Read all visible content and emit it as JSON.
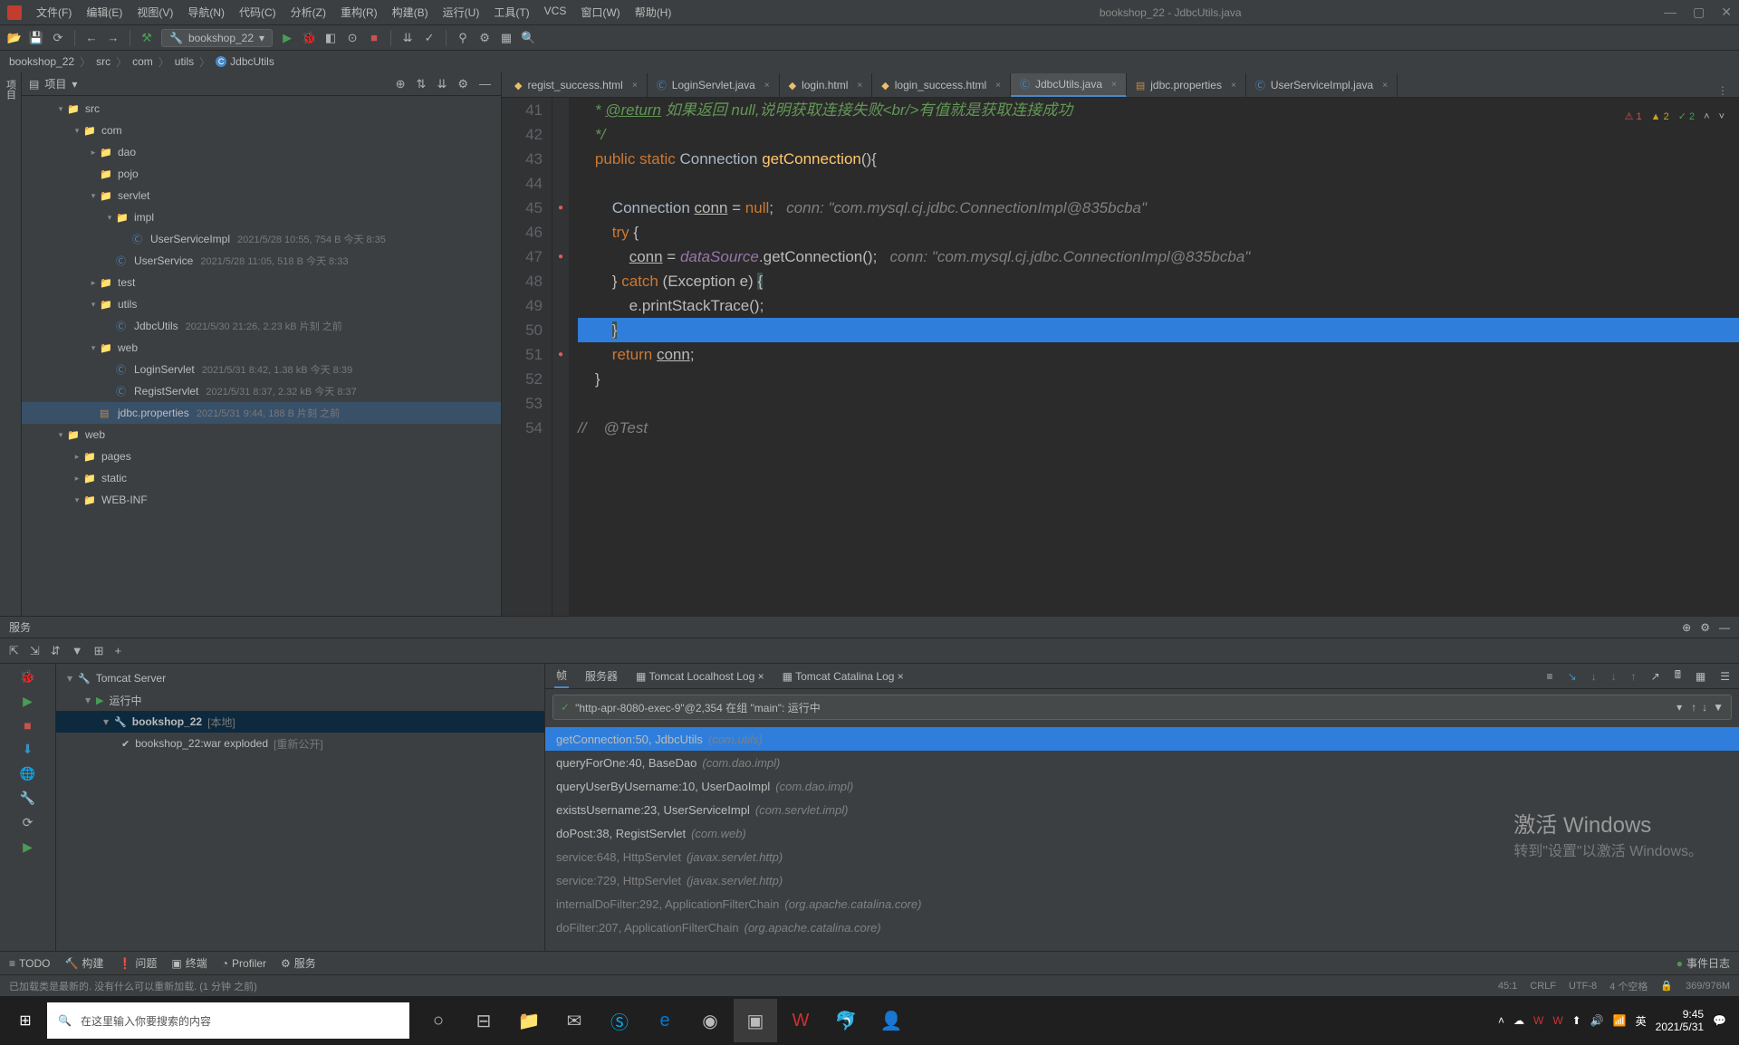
{
  "window": {
    "title": "bookshop_22 - JdbcUtils.java"
  },
  "menus": [
    "文件(F)",
    "编辑(E)",
    "视图(V)",
    "导航(N)",
    "代码(C)",
    "分析(Z)",
    "重构(R)",
    "构建(B)",
    "运行(U)",
    "工具(T)",
    "VCS",
    "窗口(W)",
    "帮助(H)"
  ],
  "runconfig": "bookshop_22",
  "breadcrumb": [
    "bookshop_22",
    "src",
    "com",
    "utils",
    "JdbcUtils"
  ],
  "project_title": "项目",
  "tree": [
    {
      "d": 2,
      "ic": "dir",
      "t": "src",
      "arrow": "▾"
    },
    {
      "d": 3,
      "ic": "dir",
      "t": "com",
      "arrow": "▾"
    },
    {
      "d": 4,
      "ic": "dir",
      "t": "dao",
      "arrow": "▸"
    },
    {
      "d": 4,
      "ic": "dir",
      "t": "pojo",
      "arrow": ""
    },
    {
      "d": 4,
      "ic": "dir",
      "t": "servlet",
      "arrow": "▾"
    },
    {
      "d": 5,
      "ic": "dir",
      "t": "impl",
      "arrow": "▾"
    },
    {
      "d": 6,
      "ic": "cls",
      "t": "UserServiceImpl",
      "meta": "2021/5/28 10:55, 754 B 今天 8:35"
    },
    {
      "d": 5,
      "ic": "cls",
      "t": "UserService",
      "meta": "2021/5/28 11:05, 518 B 今天 8:33"
    },
    {
      "d": 4,
      "ic": "dir",
      "t": "test",
      "arrow": "▸"
    },
    {
      "d": 4,
      "ic": "dir",
      "t": "utils",
      "arrow": "▾"
    },
    {
      "d": 5,
      "ic": "cls",
      "t": "JdbcUtils",
      "meta": "2021/5/30 21:26, 2.23 kB 片刻 之前"
    },
    {
      "d": 4,
      "ic": "dir",
      "t": "web",
      "arrow": "▾"
    },
    {
      "d": 5,
      "ic": "cls",
      "t": "LoginServlet",
      "meta": "2021/5/31 8:42, 1.38 kB 今天 8:39"
    },
    {
      "d": 5,
      "ic": "cls",
      "t": "RegistServlet",
      "meta": "2021/5/31 8:37, 2.32 kB 今天 8:37"
    },
    {
      "d": 4,
      "ic": "prop",
      "t": "jdbc.properties",
      "meta": "2021/5/31 9:44, 188 B 片刻 之前",
      "sel": true
    },
    {
      "d": 2,
      "ic": "dir",
      "t": "web",
      "arrow": "▾"
    },
    {
      "d": 3,
      "ic": "dir",
      "t": "pages",
      "arrow": "▸"
    },
    {
      "d": 3,
      "ic": "dir",
      "t": "static",
      "arrow": "▸"
    },
    {
      "d": 3,
      "ic": "dir",
      "t": "WEB-INF",
      "arrow": "▾"
    }
  ],
  "tabs": [
    {
      "t": "regist_success.html"
    },
    {
      "t": "LoginServlet.java"
    },
    {
      "t": "login.html"
    },
    {
      "t": "login_success.html"
    },
    {
      "t": "JdbcUtils.java",
      "active": true
    },
    {
      "t": "jdbc.properties"
    },
    {
      "t": "UserServiceImpl.java"
    }
  ],
  "inspect": {
    "err": "1",
    "warn": "2",
    "ok": "2"
  },
  "code_lines": [
    {
      "n": 41,
      "html": "    <span class='cmt-green'>* <u>@return</u> 如果返回 null,说明获取连接失败&lt;br/&gt;有值就是获取连接成功</span>"
    },
    {
      "n": 42,
      "html": "    <span class='cmt-green'>*/</span>"
    },
    {
      "n": 43,
      "html": "    <span class='kw'>public static</span> <span class='type'>Connection</span> <span class='fn'>getConnection</span>(){"
    },
    {
      "n": 44,
      "html": ""
    },
    {
      "n": 45,
      "bp": true,
      "html": "        <span class='type'>Connection</span> <u>conn</u> = <span class='kw'>null</span>;   <span class='cmt'>conn: \"com.mysql.cj.jdbc.ConnectionImpl@835bcba\"</span>"
    },
    {
      "n": 46,
      "html": "        <span class='kw'>try</span> {"
    },
    {
      "n": 47,
      "bp": true,
      "html": "            <u>conn</u> = <span style='font-style:italic;color:#9876aa'>dataSource</span>.getConnection();   <span class='cmt'>conn: \"com.mysql.cj.jdbc.ConnectionImpl@835bcba\"</span>"
    },
    {
      "n": 48,
      "html": "        } <span class='kw'>catch</span> (Exception e) <span style='background:#3b514d'>{</span>"
    },
    {
      "n": 49,
      "html": "            e.printStackTrace();"
    },
    {
      "n": 50,
      "hl": true,
      "html": "        <span style='background:#3b514d'>}</span>"
    },
    {
      "n": 51,
      "bp": true,
      "html": "        <span class='kw'>return</span> <u>conn</u>;"
    },
    {
      "n": 52,
      "html": "    }"
    },
    {
      "n": 53,
      "html": ""
    },
    {
      "n": 54,
      "html": "<span class='cmt'>//    @Test</span>"
    }
  ],
  "debug": {
    "title": "服务",
    "runtree": [
      {
        "d": 0,
        "t": "Tomcat Server",
        "ic": "🔧",
        "arrow": "▾"
      },
      {
        "d": 1,
        "t": "运行中",
        "ic": "▶",
        "arrow": "▾",
        "green": true
      },
      {
        "d": 2,
        "t": "bookshop_22",
        "suffix": "[本地]",
        "ic": "🔧",
        "arrow": "▾",
        "sel": true
      },
      {
        "d": 3,
        "t": "bookshop_22:war exploded",
        "suffix": "[重新公开]",
        "ic": "✔"
      }
    ],
    "tabs": [
      "帧",
      "服务器",
      "Tomcat Localhost Log",
      "Tomcat Catalina Log"
    ],
    "thread": "\"http-apr-8080-exec-9\"@2,354 在组 \"main\": 运行中",
    "stack": [
      {
        "m": "getConnection:50, JdbcUtils",
        "p": "(com.utils)",
        "sel": true
      },
      {
        "m": "queryForOne:40, BaseDao",
        "p": "(com.dao.impl)"
      },
      {
        "m": "queryUserByUsername:10, UserDaoImpl",
        "p": "(com.dao.impl)"
      },
      {
        "m": "existsUsername:23, UserServiceImpl",
        "p": "(com.servlet.impl)"
      },
      {
        "m": "doPost:38, RegistServlet",
        "p": "(com.web)"
      },
      {
        "m": "service:648, HttpServlet",
        "p": "(javax.servlet.http)",
        "dim": true
      },
      {
        "m": "service:729, HttpServlet",
        "p": "(javax.servlet.http)",
        "dim": true
      },
      {
        "m": "internalDoFilter:292, ApplicationFilterChain",
        "p": "(org.apache.catalina.core)",
        "dim": true
      },
      {
        "m": "doFilter:207, ApplicationFilterChain",
        "p": "(org.apache.catalina.core)",
        "dim": true
      }
    ]
  },
  "bottom_tabs": [
    "TODO",
    "构建",
    "问题",
    "终端",
    "Profiler",
    "服务"
  ],
  "status": {
    "msg": "已加载类是最新的. 没有什么可以重新加载. (1 分钟 之前)",
    "pos": "45:1",
    "crlf": "CRLF",
    "enc": "UTF-8",
    "indent": "4 个空格",
    "mem": "369/976M",
    "event": "事件日志"
  },
  "watermark": {
    "l1": "激活 Windows",
    "l2": "转到\"设置\"以激活 Windows。"
  },
  "taskbar": {
    "search": "在这里输入你要搜索的内容",
    "time": "9:45",
    "date": "2021/5/31",
    "ime": "英"
  }
}
